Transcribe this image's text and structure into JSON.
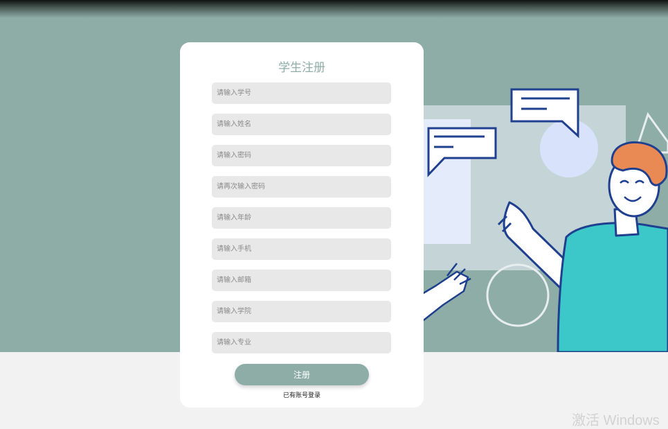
{
  "form": {
    "title": "学生注册",
    "fields": [
      {
        "placeholder": "请输入学号"
      },
      {
        "placeholder": "请输入姓名"
      },
      {
        "placeholder": "请输入密码"
      },
      {
        "placeholder": "请再次输入密码"
      },
      {
        "placeholder": "请输入年龄"
      },
      {
        "placeholder": "请输入手机"
      },
      {
        "placeholder": "请输入邮箱"
      },
      {
        "placeholder": "请输入学院"
      },
      {
        "placeholder": "请输入专业"
      }
    ],
    "register_label": "注册",
    "login_link": "已有账号登录"
  },
  "watermark": "激活 Windows",
  "colors": {
    "accent": "#8fada7",
    "figure_shirt": "#3cc8c8",
    "hair": "#e98a55",
    "outline": "#1f3f8f"
  }
}
